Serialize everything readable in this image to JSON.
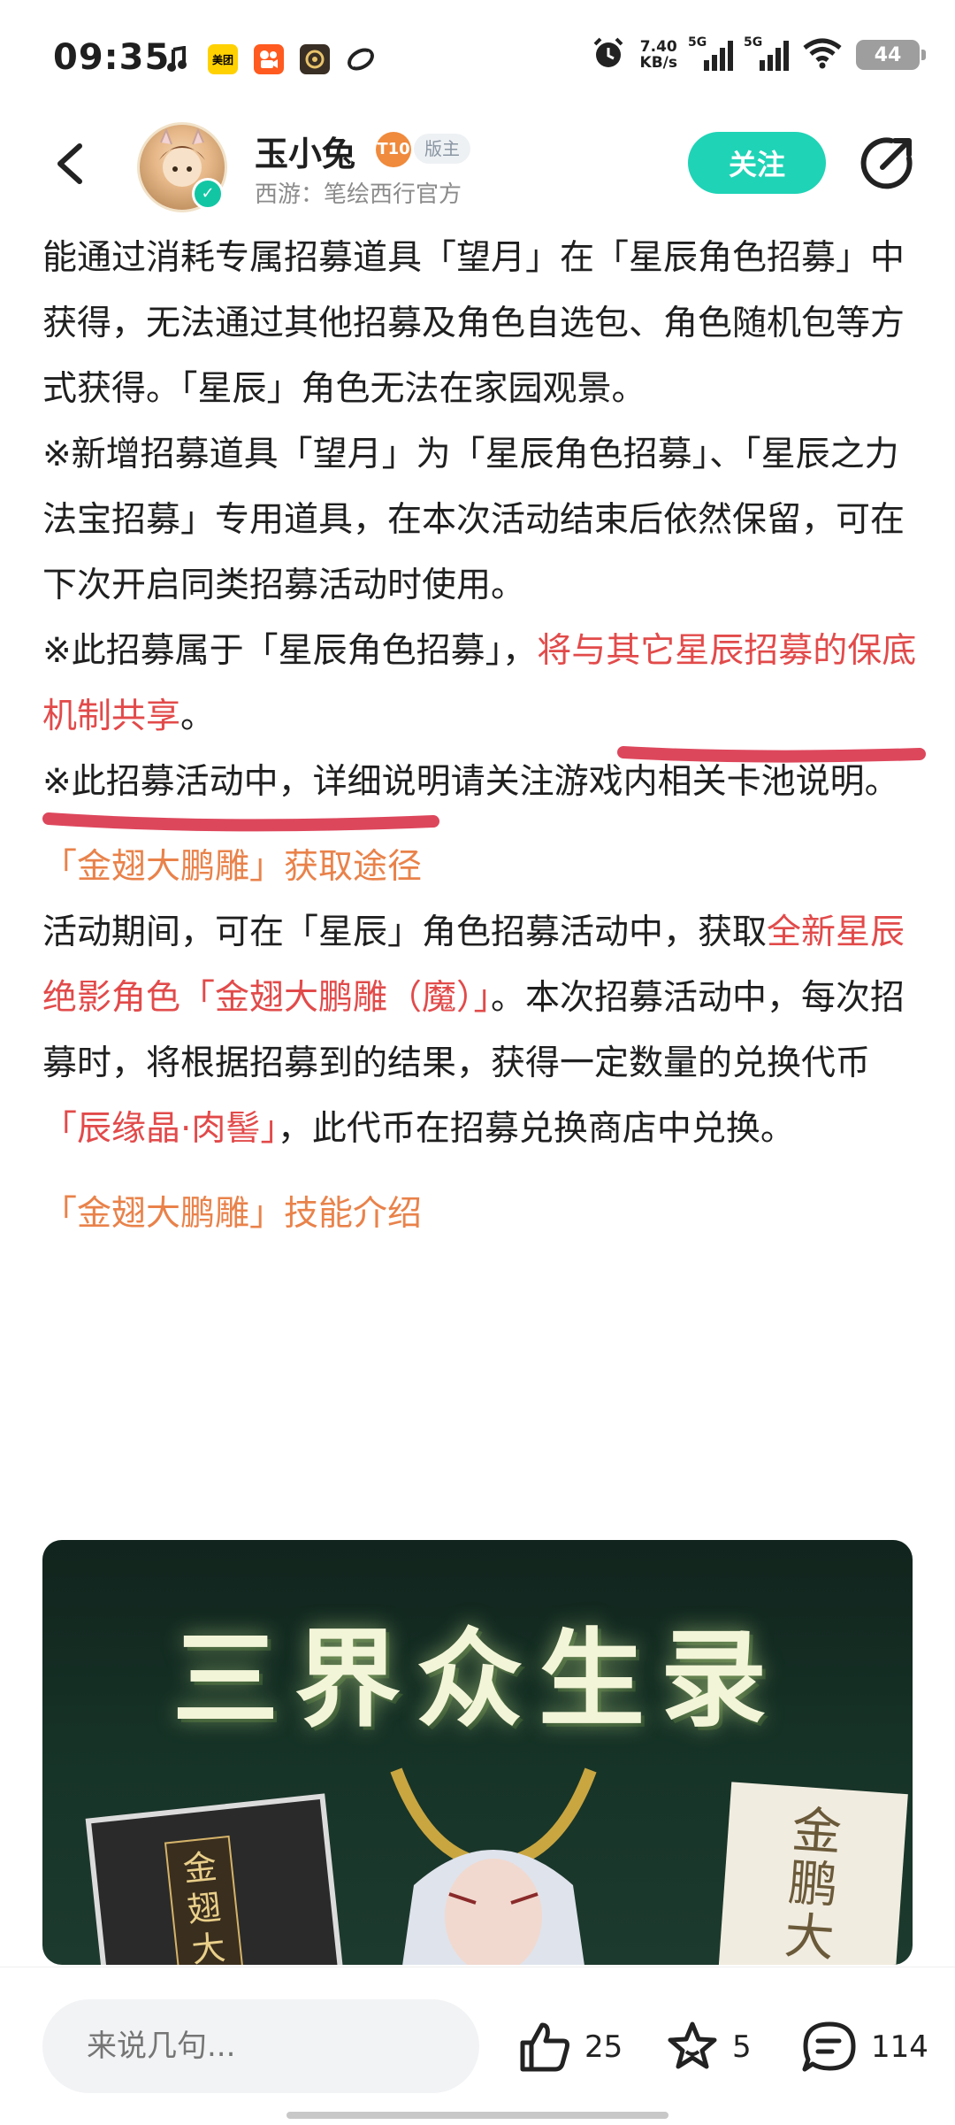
{
  "status_bar": {
    "time": "09:35",
    "app_icons": [
      "music-icon",
      "meituan-icon",
      "kuaishou-icon",
      "game-icon",
      "link-icon"
    ],
    "meituan_label": "美团",
    "net_speed_value": "7.40",
    "net_speed_unit": "KB/s",
    "signal_1": "5G",
    "signal_2": "5G",
    "battery": "44"
  },
  "header": {
    "user_name": "玉小兔",
    "level_badge": "T10",
    "role_badge": "版主",
    "subtitle": "西游：笔绘西行官方",
    "follow_label": "关注"
  },
  "article": {
    "p1": "能通过消耗专属招募道具「望月」在「星辰角色招募」中获得，无法通过其他招募及角色自选包、角色随机包等方式获得。「星辰」角色无法在家园观景。",
    "p2": "※新增招募道具「望月」为「星辰角色招募」、「星辰之力法宝招募」专用道具，在本次活动结束后依然保留，可在下次开启同类招募活动时使用。",
    "p3_a": "※此招募属于「星辰角色招募」，",
    "p3_red": "将与其它星辰招募的保底机制共享",
    "p3_b": "。",
    "p4": "※此招募活动中，详细说明请关注游戏内相关卡池说明。",
    "section1_title": "「金翅大鹏雕」获取途径",
    "p5_a": "活动期间，可在「星辰」角色招募活动中，获取",
    "p5_red": "全新星辰绝影角色「金翅大鹏雕（魔）」",
    "p5_b": "。本次招募活动中，每次招募时，将根据招募到的结果，获得一定数量的兑换代币",
    "p5_red2": "「辰缘晶·肉髻」",
    "p5_c": "，此代币在招募兑换商店中兑换。",
    "section2_title": "「金翅大鹏雕」技能介绍",
    "banner_title": "三界众生录",
    "banner_card_left": "金翅大鹏",
    "banner_card_right": "金鹏大鵬"
  },
  "bottom_bar": {
    "comment_placeholder": "来说几句...",
    "likes": "25",
    "favorites": "5",
    "comments": "114"
  },
  "colors": {
    "accent_teal": "#1fd3b6",
    "section_orange": "#e9824a",
    "highlight_red": "#e24a4a",
    "annotation_red": "#d9334a"
  }
}
